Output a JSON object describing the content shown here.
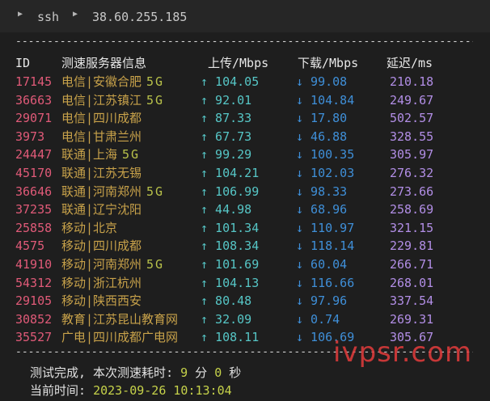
{
  "tab": {
    "crumbs": [
      "ssh",
      "38.60.255.185"
    ],
    "separator_icon": "triangle-right-icon"
  },
  "table": {
    "divider": "---------------------------------------------------------------------------------",
    "headers": {
      "id": "ID",
      "server": "测速服务器信息",
      "upload": "上传/Mbps",
      "download": "下载/Mbps",
      "latency": "延迟/ms"
    },
    "rows": [
      {
        "id": "17145",
        "server": "电信|安徽合肥",
        "tag": "5G",
        "upload": "↑ 104.05",
        "download": "↓ 99.08",
        "latency": "210.18"
      },
      {
        "id": "36663",
        "server": "电信|江苏镇江",
        "tag": "5G",
        "upload": "↑ 92.01",
        "download": "↓ 104.84",
        "latency": "249.67"
      },
      {
        "id": "29071",
        "server": "电信|四川成都",
        "tag": "",
        "upload": "↑ 87.33",
        "download": "↓ 17.80",
        "latency": "502.57"
      },
      {
        "id": "3973",
        "server": "电信|甘肃兰州",
        "tag": "",
        "upload": "↑ 67.73",
        "download": "↓ 46.88",
        "latency": "328.55"
      },
      {
        "id": "24447",
        "server": "联通|上海",
        "tag": "5G",
        "upload": "↑ 99.29",
        "download": "↓ 100.35",
        "latency": "305.97"
      },
      {
        "id": "45170",
        "server": "联通|江苏无锡",
        "tag": "",
        "upload": "↑ 104.21",
        "download": "↓ 102.03",
        "latency": "276.32"
      },
      {
        "id": "36646",
        "server": "联通|河南郑州",
        "tag": "5G",
        "upload": "↑ 106.99",
        "download": "↓ 98.33",
        "latency": "273.66"
      },
      {
        "id": "37235",
        "server": "联通|辽宁沈阳",
        "tag": "",
        "upload": "↑ 44.98",
        "download": "↓ 68.96",
        "latency": "258.69"
      },
      {
        "id": "25858",
        "server": "移动|北京",
        "tag": "",
        "upload": "↑ 101.34",
        "download": "↓ 110.97",
        "latency": "321.15"
      },
      {
        "id": "4575",
        "server": "移动|四川成都",
        "tag": "",
        "upload": "↑ 108.34",
        "download": "↓ 118.14",
        "latency": "229.81"
      },
      {
        "id": "41910",
        "server": "移动|河南郑州",
        "tag": "5G",
        "upload": "↑ 101.69",
        "download": "↓ 60.04",
        "latency": "266.71"
      },
      {
        "id": "54312",
        "server": "移动|浙江杭州",
        "tag": "",
        "upload": "↑ 104.13",
        "download": "↓ 116.66",
        "latency": "268.01"
      },
      {
        "id": "29105",
        "server": "移动|陕西西安",
        "tag": "",
        "upload": "↑ 80.48",
        "download": "↓ 97.96",
        "latency": "337.54"
      },
      {
        "id": "30852",
        "server": "教育|江苏昆山教育网",
        "tag": "",
        "upload": "↑ 32.09",
        "download": "↓ 0.74",
        "latency": "269.31"
      },
      {
        "id": "35527",
        "server": "广电|四川成都广电网",
        "tag": "",
        "upload": "↑ 108.11",
        "download": "↓ 106.69",
        "latency": "305.67"
      }
    ]
  },
  "summary": {
    "done_label": "测试完成, 本次测速耗时: ",
    "minutes": "9",
    "minutes_unit": " 分 ",
    "seconds": "0",
    "seconds_unit": " 秒",
    "time_label": "当前时间: ",
    "time_value": "2023-09-26 10:13:04"
  },
  "watermark": "ivpsr.com",
  "colors": {
    "id": "#e05a78",
    "server": "#c8a24a",
    "upload": "#56c6c6",
    "download": "#3f8fd8",
    "latency": "#b28ee6",
    "watermark": "#e43c3c"
  }
}
